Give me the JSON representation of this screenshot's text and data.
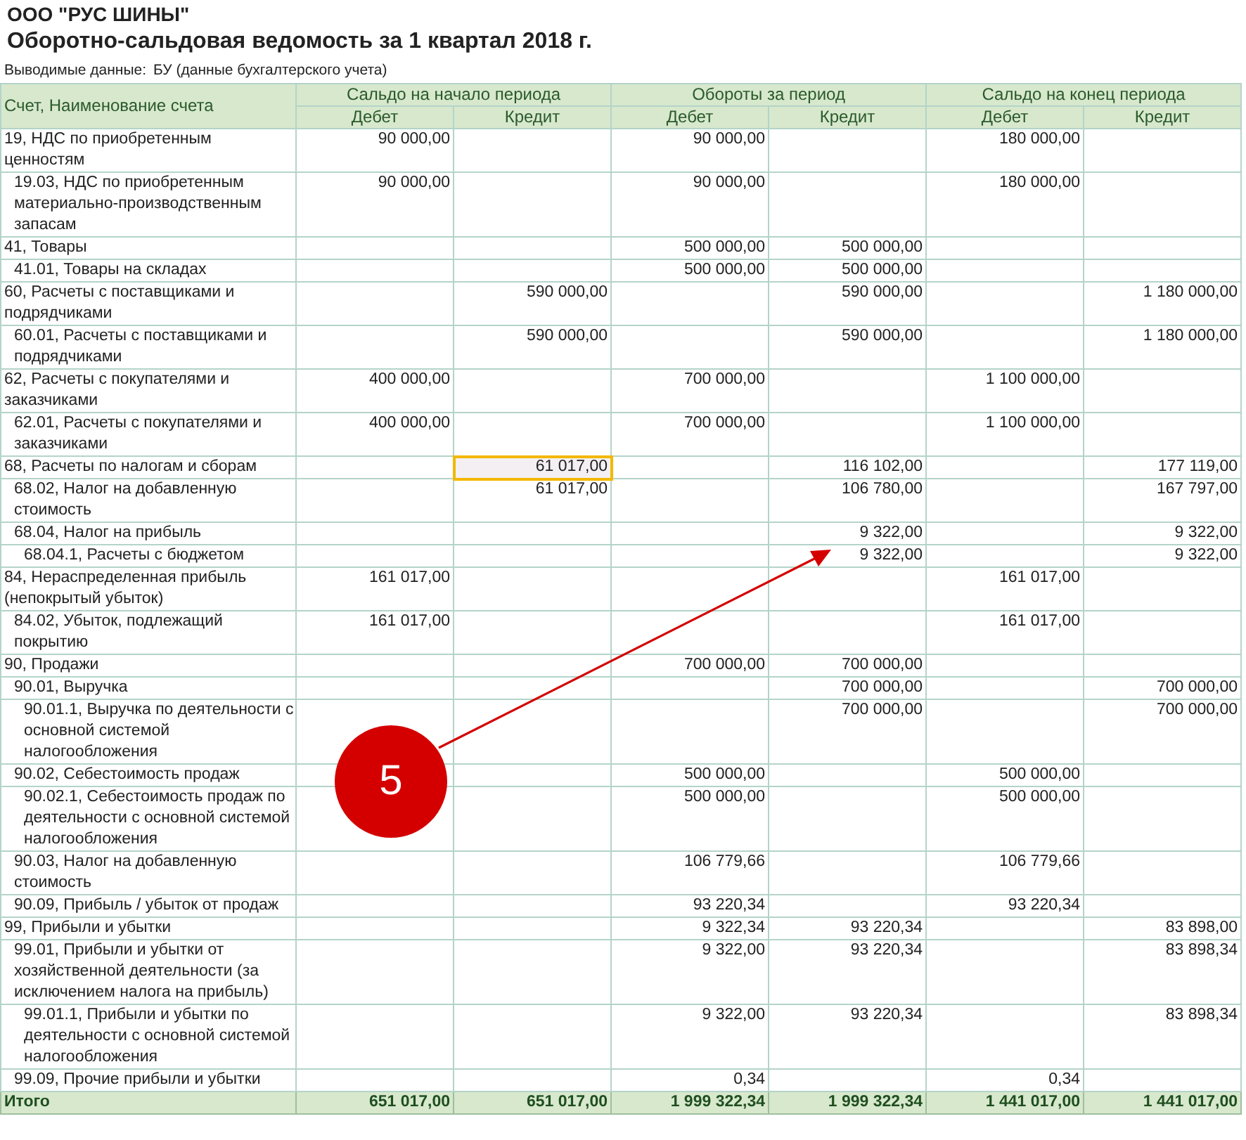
{
  "company": "ООО \"РУС ШИНЫ\"",
  "title": "Оборотно-сальдовая ведомость за 1 квартал 2018 г.",
  "output_data": {
    "label": "Выводимые данные:",
    "value": "БУ (данные бухгалтерского учета)"
  },
  "columns": {
    "account": "Счет, Наименование счета",
    "groups": [
      {
        "label": "Сальдо на начало периода",
        "debit": "Дебет",
        "credit": "Кредит"
      },
      {
        "label": "Обороты за период",
        "debit": "Дебет",
        "credit": "Кредит"
      },
      {
        "label": "Сальдо на конец периода",
        "debit": "Дебет",
        "credit": "Кредит"
      }
    ]
  },
  "rows": [
    {
      "account": "19, НДС по приобретенным ценностям",
      "open_debit": "90 000,00",
      "turn_debit": "90 000,00",
      "close_debit": "180 000,00",
      "children": [
        {
          "account": "19.03, НДС по приобретенным материально-производственным запасам",
          "open_debit": "90 000,00",
          "turn_debit": "90 000,00",
          "close_debit": "180 000,00"
        }
      ]
    },
    {
      "account": "41, Товары",
      "turn_debit": "500 000,00",
      "turn_credit": "500 000,00",
      "children": [
        {
          "account": "41.01, Товары на складах",
          "turn_debit": "500 000,00",
          "turn_credit": "500 000,00"
        }
      ]
    },
    {
      "account": "60, Расчеты с поставщиками и подрядчиками",
      "open_credit": "590 000,00",
      "turn_credit": "590 000,00",
      "close_credit": "1 180 000,00",
      "children": [
        {
          "account": "60.01, Расчеты с поставщиками и подрядчиками",
          "open_credit": "590 000,00",
          "turn_credit": "590 000,00",
          "close_credit": "1 180 000,00"
        }
      ]
    },
    {
      "account": "62, Расчеты с покупателями и заказчиками",
      "open_debit": "400 000,00",
      "turn_debit": "700 000,00",
      "close_debit": "1 100 000,00",
      "children": [
        {
          "account": "62.01, Расчеты с покупателями и заказчиками",
          "open_debit": "400 000,00",
          "turn_debit": "700 000,00",
          "close_debit": "1 100 000,00"
        }
      ]
    },
    {
      "account": "68, Расчеты по налогам и сборам",
      "open_credit": {
        "text": "61 017,00",
        "selected": true
      },
      "turn_credit": "116 102,00",
      "close_credit": "177 119,00",
      "children": [
        {
          "account": "68.02, Налог на добавленную стоимость",
          "open_credit": "61 017,00",
          "turn_credit": "106 780,00",
          "close_credit": "167 797,00"
        },
        {
          "account": "68.04, Налог на прибыль",
          "turn_credit": "9 322,00",
          "close_credit": "9 322,00",
          "children": [
            {
              "account": "68.04.1, Расчеты с бюджетом",
              "turn_credit": "9 322,00",
              "close_credit": "9 322,00"
            }
          ]
        }
      ]
    },
    {
      "account": "84, Нераспределенная прибыль (непокрытый убыток)",
      "open_debit": "161 017,00",
      "close_debit": "161 017,00",
      "children": [
        {
          "account": "84.02, Убыток, подлежащий покрытию",
          "open_debit": "161 017,00",
          "close_debit": "161 017,00"
        }
      ]
    },
    {
      "account": "90, Продажи",
      "turn_debit": "700 000,00",
      "turn_credit": "700 000,00",
      "children": [
        {
          "account": "90.01, Выручка",
          "turn_credit": "700 000,00",
          "close_credit": "700 000,00",
          "children": [
            {
              "account": "90.01.1, Выручка по деятельности с основной системой налогообложения",
              "turn_credit": "700 000,00",
              "close_credit": "700 000,00"
            }
          ]
        },
        {
          "account": "90.02, Себестоимость продаж",
          "turn_debit": "500 000,00",
          "close_debit": "500 000,00",
          "children": [
            {
              "account": "90.02.1, Себестоимость продаж по деятельности с основной системой налогообложения",
              "turn_debit": "500 000,00",
              "close_debit": "500 000,00"
            }
          ]
        },
        {
          "account": "90.03, Налог на добавленную стоимость",
          "turn_debit": "106 779,66",
          "close_debit": "106 779,66"
        },
        {
          "account": "90.09, Прибыль / убыток от продаж",
          "turn_debit": "93 220,34",
          "close_debit": "93 220,34"
        }
      ]
    },
    {
      "account": "99, Прибыли и убытки",
      "turn_debit": "9 322,34",
      "turn_credit": "93 220,34",
      "close_credit": "83 898,00",
      "children": [
        {
          "account": "99.01, Прибыли и убытки от хозяйственной деятельности (за исключением налога на прибыль)",
          "turn_debit": "9 322,00",
          "turn_credit": "93 220,34",
          "close_credit": "83 898,34",
          "children": [
            {
              "account": "99.01.1, Прибыли и убытки по деятельности с основной системой налогообложения",
              "turn_debit": "9 322,00",
              "turn_credit": "93 220,34",
              "close_credit": "83 898,34"
            }
          ]
        },
        {
          "account": "99.09, Прочие прибыли и убытки",
          "turn_debit": "0,34",
          "close_debit": "0,34"
        }
      ]
    }
  ],
  "total": {
    "account": "Итого",
    "open_debit": "651 017,00",
    "open_credit": "651 017,00",
    "turn_debit": "1 999 322,34",
    "turn_credit": "1 999 322,34",
    "close_debit": "1 441 017,00",
    "close_credit": "1 441 017,00"
  },
  "annotation": {
    "label": "5"
  }
}
